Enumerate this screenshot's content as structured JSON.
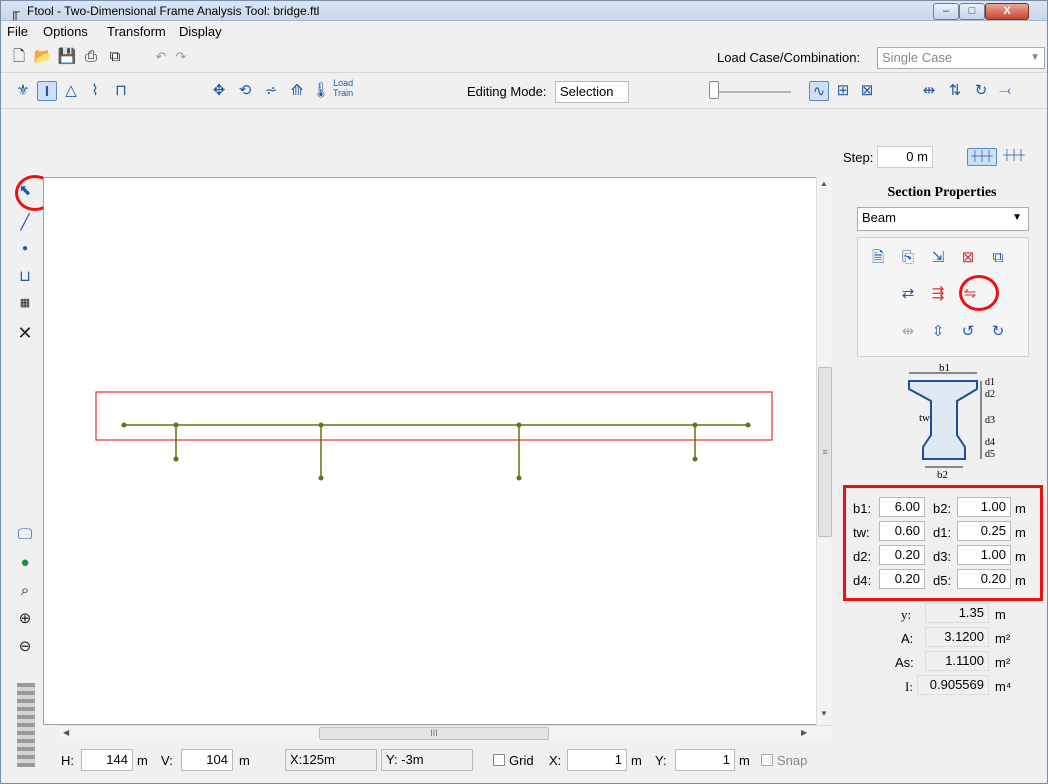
{
  "window": {
    "title": "Ftool - Two-Dimensional Frame Analysis Tool: bridge.ftl",
    "min_glyph": "–",
    "max_glyph": "□",
    "close_glyph": "X"
  },
  "menu": [
    "File",
    "Options",
    "Transform",
    "Display"
  ],
  "toolbar1": {
    "load_case_label": "Load Case/Combination:",
    "load_case_value": "Single Case"
  },
  "toolbar2": {
    "load_train_label": "Load\nTrain",
    "editing_mode_label": "Editing Mode:",
    "editing_mode_value": "Selection"
  },
  "toolbar3": {
    "step_label": "Step:",
    "step_value": "0",
    "step_unit": "m"
  },
  "left_tools": {
    "upper": [
      "pointer-icon",
      "line-icon",
      "node-icon",
      "dimension-icon",
      "ruler-icon",
      "delete-icon"
    ],
    "lower": [
      "display-icon",
      "globe-icon",
      "zoom-icon",
      "zoom-in-icon",
      "zoom-out-icon"
    ]
  },
  "section_panel": {
    "title": "Section Properties",
    "section_type": "Beam",
    "diagram_labels": {
      "b1": "b1",
      "b2": "b2",
      "tw": "tw",
      "d1": "d1",
      "d2": "d2",
      "d3": "d3",
      "d4": "d4",
      "d5": "d5"
    },
    "params": [
      {
        "label": "b1:",
        "value": "6.00",
        "label2": "b2:",
        "value2": "1.00",
        "unit": "m"
      },
      {
        "label": "tw:",
        "value": "0.60",
        "label2": "d1:",
        "value2": "0.25",
        "unit": "m"
      },
      {
        "label": "d2:",
        "value": "0.20",
        "label2": "d3:",
        "value2": "1.00",
        "unit": "m"
      },
      {
        "label": "d4:",
        "value": "0.20",
        "label2": "d5:",
        "value2": "0.20",
        "unit": "m"
      }
    ],
    "results": [
      {
        "label": "y:",
        "value": "1.35",
        "unit": "m"
      },
      {
        "label": "A:",
        "value": "3.1200",
        "unit": "m²"
      },
      {
        "label": "As:",
        "value": "1.1100",
        "unit": "m²"
      },
      {
        "label": "I:",
        "value": "0.905569",
        "unit": "m⁴"
      }
    ]
  },
  "statusbar": {
    "h_label": "H:",
    "h_value": "144",
    "h_unit": "m",
    "v_label": "V:",
    "v_value": "104",
    "v_unit": "m",
    "x_coord": "X:125m",
    "y_coord": "Y: -3m",
    "grid_label": "Grid",
    "gx_label": "X:",
    "gx_value": "1",
    "gx_unit": "m",
    "gy_label": "Y:",
    "gy_value": "1",
    "gy_unit": "m",
    "snap_label": "Snap"
  },
  "scroll": {
    "h_grip": "III",
    "v_grip": "≡"
  },
  "colors": {
    "frame": "#6e6e14",
    "selection_box": "#e03030",
    "highlight": "#e11111"
  }
}
